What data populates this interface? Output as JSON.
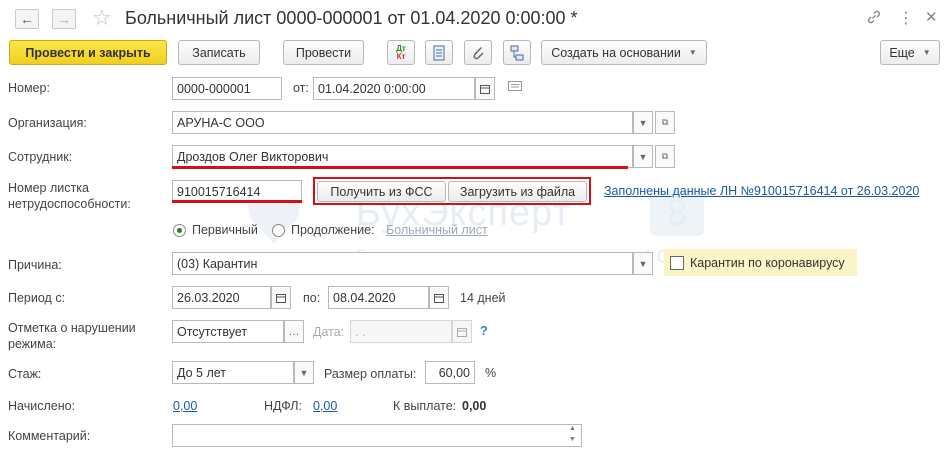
{
  "header": {
    "title": "Больничный лист 0000-000001 от 01.04.2020 0:00:00 *",
    "back_icon": "←",
    "forward_icon": "→",
    "star_icon": "☆",
    "link_icon": "🔗",
    "more_icon": "⋮",
    "close_icon": "✕"
  },
  "toolbar": {
    "post_and_close": "Провести и закрыть",
    "save": "Записать",
    "post": "Провести",
    "dt_kt_top": "Дт",
    "dt_kt_bottom": "Кт",
    "create_based_on": "Создать на основании",
    "more": "Еще"
  },
  "form": {
    "number_label": "Номер:",
    "number_value": "0000-000001",
    "date_from_label": "от:",
    "date_value": "01.04.2020  0:00:00",
    "organization_label": "Организация:",
    "organization_value": "АРУНА-С ООО",
    "employee_label": "Сотрудник:",
    "employee_value": "Дроздов Олег Викторович",
    "sheet_number_label_1": "Номер листка",
    "sheet_number_label_2": "нетрудоспособности:",
    "sheet_number_value": "910015716414",
    "get_from_fss": "Получить из ФСС",
    "load_from_file": "Загрузить из файла",
    "filled_data_link": "Заполнены данные ЛН №910015716414 от 26.03.2020",
    "primary_label": "Первичный",
    "continuation_label": "Продолжение:",
    "continuation_link": "Больничный лист",
    "reason_label": "Причина:",
    "reason_value": "(03) Карантин",
    "corona_label": "Карантин по коронавирусу",
    "period_label": "Период с:",
    "period_from": "26.03.2020",
    "period_to_label": "по:",
    "period_to": "08.04.2020",
    "period_days": "14 дней",
    "violation_label_1": "Отметка о нарушении",
    "violation_label_2": "режима:",
    "violation_value": "Отсутствует",
    "violation_date_label": "Дата:",
    "violation_date_value": " .  .",
    "help_mark": "?",
    "experience_label": "Стаж:",
    "experience_value": "До 5 лет",
    "pay_size_label": "Размер оплаты:",
    "pay_size_value": "60,00",
    "percent_sign": "%",
    "accrued_label": "Начислено:",
    "accrued_value": "0,00",
    "ndfl_label": "НДФЛ:",
    "ndfl_value": "0,00",
    "to_pay_label": "К выплате:",
    "to_pay_value": "0,00",
    "comment_label": "Комментарий:",
    "comment_value": ""
  },
  "watermark": {
    "brand": "БухЭксперт",
    "brand_number": "8",
    "tagline": "База ответов по учету в 1С"
  },
  "colors": {
    "accent_yellow": "#f5d62a",
    "highlight_red": "#d30f17",
    "link_blue": "#1b5a9e",
    "corona_bg": "#fbf4c4"
  }
}
